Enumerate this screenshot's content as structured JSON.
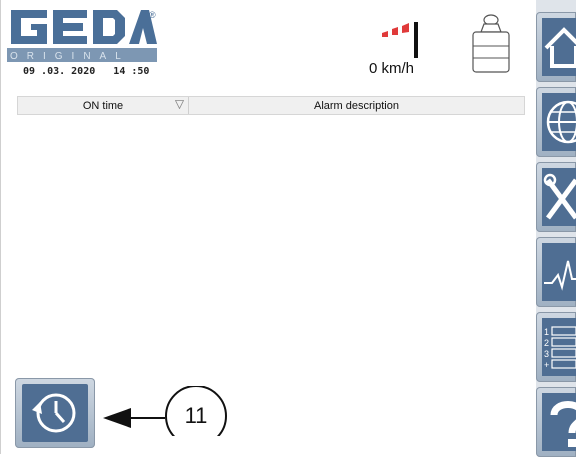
{
  "header": {
    "brand": "GEDA",
    "brand_sub": "ORIGINAL",
    "trademark": "®",
    "datetime": "09 .03. 2020   14 :50",
    "wind_speed": "0 km/h"
  },
  "alarm_table": {
    "columns": [
      "ON time",
      "Alarm description"
    ],
    "rows": []
  },
  "history_button": {
    "callout_number": "11"
  },
  "sidebar": {
    "items": [
      "home",
      "globe",
      "tools",
      "graph",
      "list",
      "help"
    ]
  },
  "colors": {
    "button_face": "#4f6e93",
    "brand_blue": "#4a6f98"
  }
}
